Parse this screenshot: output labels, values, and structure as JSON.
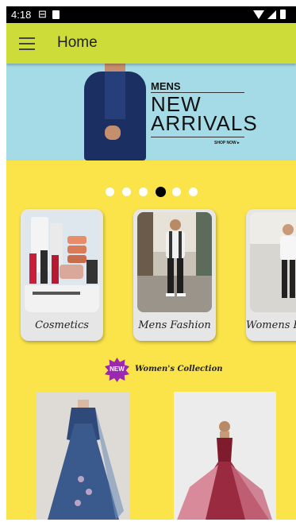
{
  "status_bar": {
    "time": "4:18",
    "sim_icon": "sim-icon",
    "icons": [
      "wifi-icon",
      "cell-signal-icon",
      "battery-icon"
    ]
  },
  "app_bar": {
    "title": "Home",
    "menu_icon": "hamburger-menu-icon",
    "color": "#cddc39"
  },
  "banner": {
    "line1": "MENS",
    "line2": "NEW",
    "line3": "ARRIVALS",
    "cta": "SHOP NOW ▸",
    "background": "#a5dbe6"
  },
  "carousel": {
    "dot_count": 6,
    "active_index": 3
  },
  "categories": [
    {
      "label": "Cosmetics",
      "icon": "cosmetics-photo"
    },
    {
      "label": "Mens Fashion",
      "icon": "mens-fashion-photo"
    },
    {
      "label": "Womens Fashion",
      "icon": "womens-fashion-photo"
    }
  ],
  "collection": {
    "badge": "NEW",
    "title": "Women's Collection",
    "badge_color": "#9c27b0"
  },
  "products": [
    {
      "icon": "blue-gown-photo"
    },
    {
      "icon": "red-gown-photo"
    }
  ],
  "page_background": "#fbe44a"
}
